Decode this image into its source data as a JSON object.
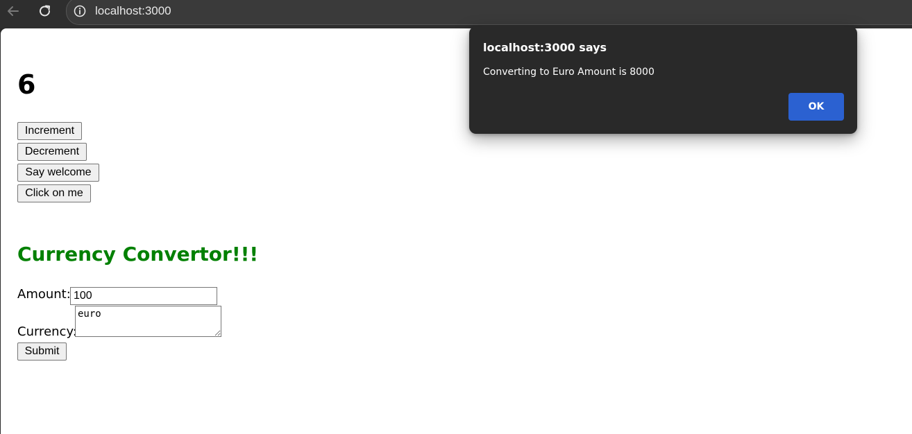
{
  "browser": {
    "url": "localhost:3000",
    "icons": {
      "back": "back-arrow-icon",
      "reload": "reload-icon",
      "site_info": "info-icon"
    }
  },
  "page": {
    "counter_value": "6",
    "buttons": {
      "increment": "Increment",
      "decrement": "Decrement",
      "say_welcome": "Say welcome",
      "click_on_me": "Click on me"
    },
    "converter": {
      "heading": "Currency Convertor!!!",
      "heading_color": "#008000",
      "amount_label": "Amount:",
      "amount_value": "100",
      "currency_label": "Currency:",
      "currency_value": "euro",
      "submit_label": "Submit"
    }
  },
  "dialog": {
    "title": "localhost:3000 says",
    "message": "Converting to Euro Amount is 8000",
    "ok_label": "OK",
    "ok_color": "#2b61d1"
  }
}
